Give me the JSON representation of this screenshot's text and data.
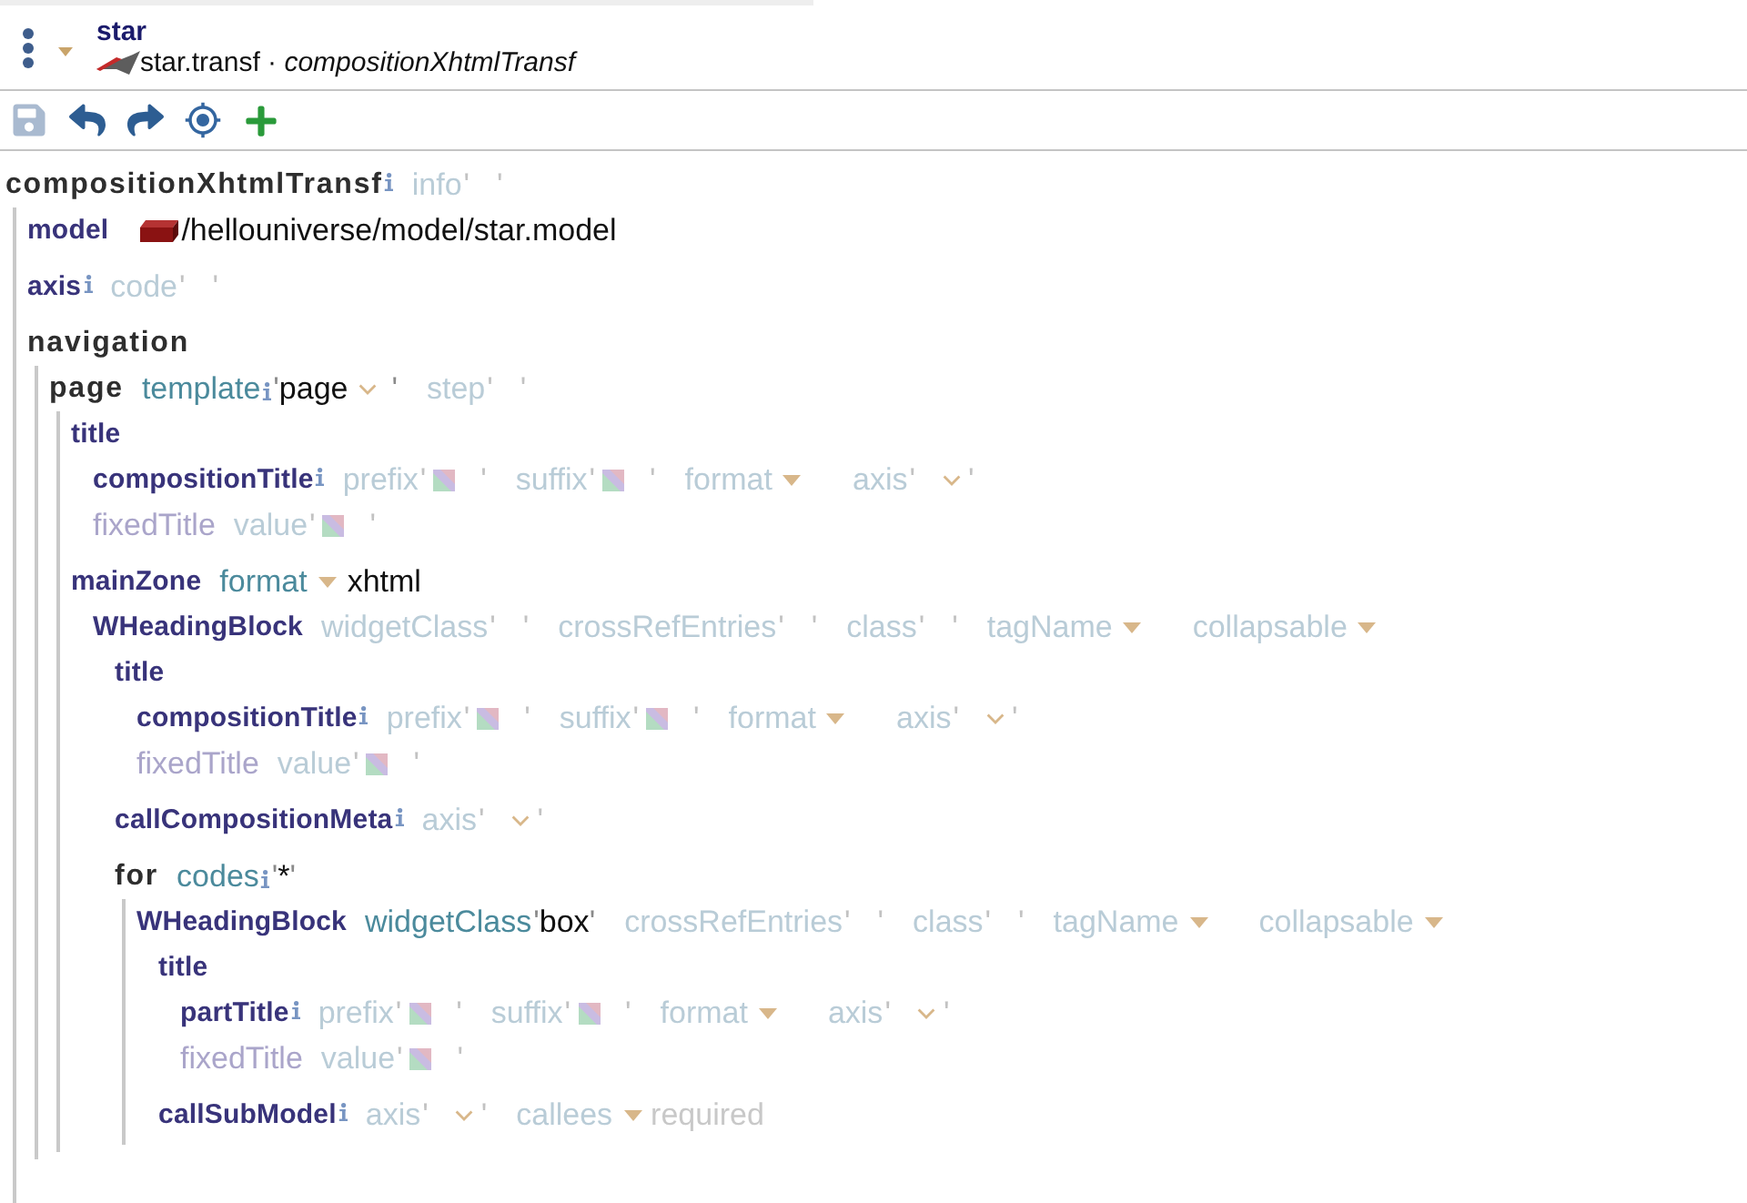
{
  "header": {
    "title": "star",
    "subtitle": "star.transf · *compositionXhtmlTransf*"
  },
  "toolbar": [
    {
      "kind": "save",
      "disabled": true
    },
    {
      "kind": "undo",
      "disabled": false
    },
    {
      "kind": "redo",
      "disabled": false
    },
    {
      "kind": "locate",
      "disabled": false
    },
    {
      "kind": "add",
      "disabled": false
    }
  ],
  "tree": {
    "keyword": "compositionXhtmlTransf",
    "kind": "container",
    "info": true,
    "fields": [
      {
        "kind": "text",
        "label": "info",
        "info": false,
        "open": "'",
        "close": "'"
      }
    ],
    "children": [
      {
        "keyword": "model",
        "kind": "element",
        "info": false,
        "fields": [
          {
            "kind": "reference",
            "info": false,
            "value": "/hellouniverse/model/star.model"
          }
        ]
      },
      {
        "keyword": "axis",
        "kind": "element",
        "info": true,
        "fields": [
          {
            "kind": "text",
            "label": "code",
            "info": false,
            "open": "'",
            "close": "'"
          }
        ]
      },
      {
        "keyword": "navigation",
        "kind": "container",
        "info": false,
        "children": [
          {
            "keyword": "page",
            "kind": "container",
            "info": false,
            "fields": [
              {
                "kind": "combo",
                "label": "template",
                "info": true,
                "open": "'",
                "value": "page",
                "close": "'"
              },
              {
                "kind": "text",
                "label": "step",
                "info": false,
                "open": "'",
                "close": "'"
              }
            ],
            "children": [
              {
                "keyword": "title",
                "kind": "element",
                "info": false,
                "children": [
                  {
                    "keyword": "compositionTitle",
                    "kind": "element",
                    "info": true,
                    "fields": [
                      {
                        "kind": "rich_text",
                        "label": "prefix",
                        "info": false,
                        "open": "'",
                        "close": "'"
                      },
                      {
                        "kind": "rich_text",
                        "label": "suffix",
                        "info": false,
                        "open": "'",
                        "close": "'"
                      },
                      {
                        "kind": "select",
                        "label": "format",
                        "info": false
                      },
                      {
                        "kind": "combo",
                        "label": "axis",
                        "info": false,
                        "open": "'",
                        "close": "'"
                      }
                    ]
                  },
                  {
                    "keyword": "fixedTitle",
                    "kind": "inactive",
                    "info": false,
                    "fields": [
                      {
                        "kind": "rich_text",
                        "label": "value",
                        "info": false,
                        "open": "'",
                        "close": "'"
                      }
                    ]
                  }
                ]
              },
              {
                "keyword": "mainZone",
                "kind": "element",
                "info": false,
                "fields": [
                  {
                    "kind": "select",
                    "label": "format",
                    "info": false,
                    "value": "xhtml"
                  }
                ],
                "children": [
                  {
                    "keyword": "WHeadingBlock",
                    "kind": "element",
                    "info": false,
                    "fields": [
                      {
                        "kind": "text",
                        "label": "widgetClass",
                        "info": false,
                        "open": "'",
                        "close": "'"
                      },
                      {
                        "kind": "text",
                        "label": "crossRefEntries",
                        "info": false,
                        "open": "'",
                        "close": "'"
                      },
                      {
                        "kind": "text",
                        "label": "class",
                        "info": false,
                        "open": "'",
                        "close": "'"
                      },
                      {
                        "kind": "select",
                        "label": "tagName",
                        "info": false
                      },
                      {
                        "kind": "select",
                        "label": "collapsable",
                        "info": false
                      }
                    ],
                    "children": [
                      {
                        "keyword": "title",
                        "kind": "element",
                        "info": false,
                        "children": [
                          {
                            "keyword": "compositionTitle",
                            "kind": "element",
                            "info": true,
                            "fields": [
                              {
                                "kind": "rich_text",
                                "label": "prefix",
                                "info": false,
                                "open": "'",
                                "close": "'"
                              },
                              {
                                "kind": "rich_text",
                                "label": "suffix",
                                "info": false,
                                "open": "'",
                                "close": "'"
                              },
                              {
                                "kind": "select",
                                "label": "format",
                                "info": false
                              },
                              {
                                "kind": "combo",
                                "label": "axis",
                                "info": false,
                                "open": "'",
                                "close": "'"
                              }
                            ]
                          },
                          {
                            "keyword": "fixedTitle",
                            "kind": "inactive",
                            "info": false,
                            "fields": [
                              {
                                "kind": "rich_text",
                                "label": "value",
                                "info": false,
                                "open": "'",
                                "close": "'"
                              }
                            ]
                          }
                        ]
                      },
                      {
                        "keyword": "callCompositionMeta",
                        "kind": "element",
                        "info": true,
                        "fields": [
                          {
                            "kind": "combo",
                            "label": "axis",
                            "info": false,
                            "open": "'",
                            "close": "'"
                          }
                        ]
                      },
                      {
                        "keyword": "for",
                        "kind": "container",
                        "info": false,
                        "fields": [
                          {
                            "kind": "text",
                            "label": "codes",
                            "info": true,
                            "open": "'",
                            "value": "*",
                            "close": "'"
                          }
                        ],
                        "children": [
                          {
                            "keyword": "WHeadingBlock",
                            "kind": "element",
                            "info": false,
                            "fields": [
                              {
                                "kind": "text",
                                "label": "widgetClass",
                                "info": false,
                                "open": "'",
                                "value": "box",
                                "close": "'"
                              },
                              {
                                "kind": "text",
                                "label": "crossRefEntries",
                                "info": false,
                                "open": "'",
                                "close": "'"
                              },
                              {
                                "kind": "text",
                                "label": "class",
                                "info": false,
                                "open": "'",
                                "close": "'"
                              },
                              {
                                "kind": "select",
                                "label": "tagName",
                                "info": false
                              },
                              {
                                "kind": "select",
                                "label": "collapsable",
                                "info": false
                              }
                            ],
                            "children": [
                              {
                                "keyword": "title",
                                "kind": "element",
                                "info": false,
                                "children": [
                                  {
                                    "keyword": "partTitle",
                                    "kind": "element",
                                    "info": true,
                                    "fields": [
                                      {
                                        "kind": "rich_text",
                                        "label": "prefix",
                                        "info": false,
                                        "open": "'",
                                        "close": "'"
                                      },
                                      {
                                        "kind": "rich_text",
                                        "label": "suffix",
                                        "info": false,
                                        "open": "'",
                                        "close": "'"
                                      },
                                      {
                                        "kind": "select",
                                        "label": "format",
                                        "info": false
                                      },
                                      {
                                        "kind": "combo",
                                        "label": "axis",
                                        "info": false,
                                        "open": "'",
                                        "close": "'"
                                      }
                                    ]
                                  },
                                  {
                                    "keyword": "fixedTitle",
                                    "kind": "inactive",
                                    "info": false,
                                    "fields": [
                                      {
                                        "kind": "rich_text",
                                        "label": "value",
                                        "info": false,
                                        "open": "'",
                                        "close": "'"
                                      }
                                    ]
                                  }
                                ]
                              },
                              {
                                "keyword": "callSubModel",
                                "kind": "element",
                                "info": true,
                                "fields": [
                                  {
                                    "kind": "combo",
                                    "label": "axis",
                                    "info": false,
                                    "open": "'",
                                    "close": "'"
                                  },
                                  {
                                    "kind": "select",
                                    "label": "callees",
                                    "info": false,
                                    "placeholder": "required"
                                  }
                                ]
                              }
                            ]
                          }
                        ]
                      }
                    ]
                  }
                ]
              }
            ]
          }
        ]
      }
    ]
  }
}
